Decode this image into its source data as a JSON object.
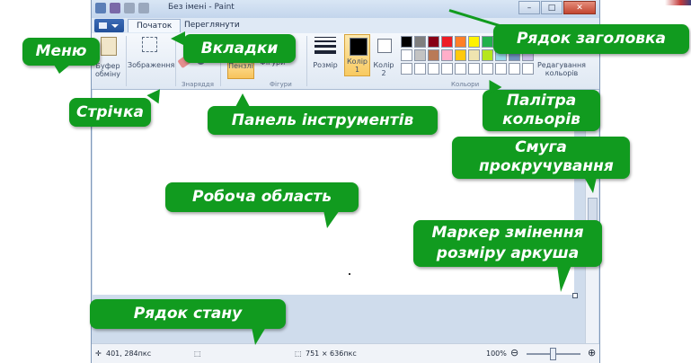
{
  "window": {
    "title": "Без імені - Paint",
    "controls": {
      "minimize": "–",
      "maximize": "□",
      "close": "✕"
    }
  },
  "tabs": [
    {
      "label": "Початок",
      "active": true
    },
    {
      "label": "Переглянути",
      "active": false
    }
  ],
  "ribbon": {
    "clipboard_label": "Буфер\nобміну",
    "image_label": "Зображення",
    "tools_group": "Знаряддя",
    "brushes_label": "Пензлі",
    "shapes_label": "Фігури",
    "shapes_group": "Фігури",
    "size_label": "Розмір",
    "color1_label": "Колір\n1",
    "color2_label": "Колір\n2",
    "colors_group": "Кольори",
    "edit_colors_label": "Редагування\nкольорів",
    "palette": [
      "#000000",
      "#7f7f7f",
      "#880015",
      "#ed1c24",
      "#ff7f27",
      "#fff200",
      "#22b14c",
      "#00a2e8",
      "#3f48cc",
      "#a349a4",
      "#ffffff",
      "#c3c3c3",
      "#b97a57",
      "#ffaec9",
      "#ffc90e",
      "#efe4b0",
      "#b5e61d",
      "#99d9ea",
      "#7092be",
      "#c8bfe7",
      "#ffffff",
      "#ffffff",
      "#ffffff",
      "#ffffff",
      "#ffffff",
      "#ffffff",
      "#ffffff",
      "#ffffff",
      "#ffffff",
      "#ffffff"
    ]
  },
  "statusbar": {
    "cursor_pos": "401, 284пкс",
    "canvas_size": "751 × 636пкс",
    "zoom": "100%"
  },
  "callouts": {
    "menu": "Меню",
    "tabs": "Вкладки",
    "titlebar": "Рядок заголовка",
    "ribbon": "Стрічка",
    "toolbar": "Панель інструментів",
    "palette": "Палітра кольорів",
    "scrollbar": "Смуга прокручування",
    "work_area": "Робоча область",
    "resize_handle": "Маркер змінення розміру аркуша",
    "statusbar": "Рядок стану"
  },
  "colors": {
    "callout_bg": "#119b1f",
    "callout_text": "#ffffff"
  }
}
